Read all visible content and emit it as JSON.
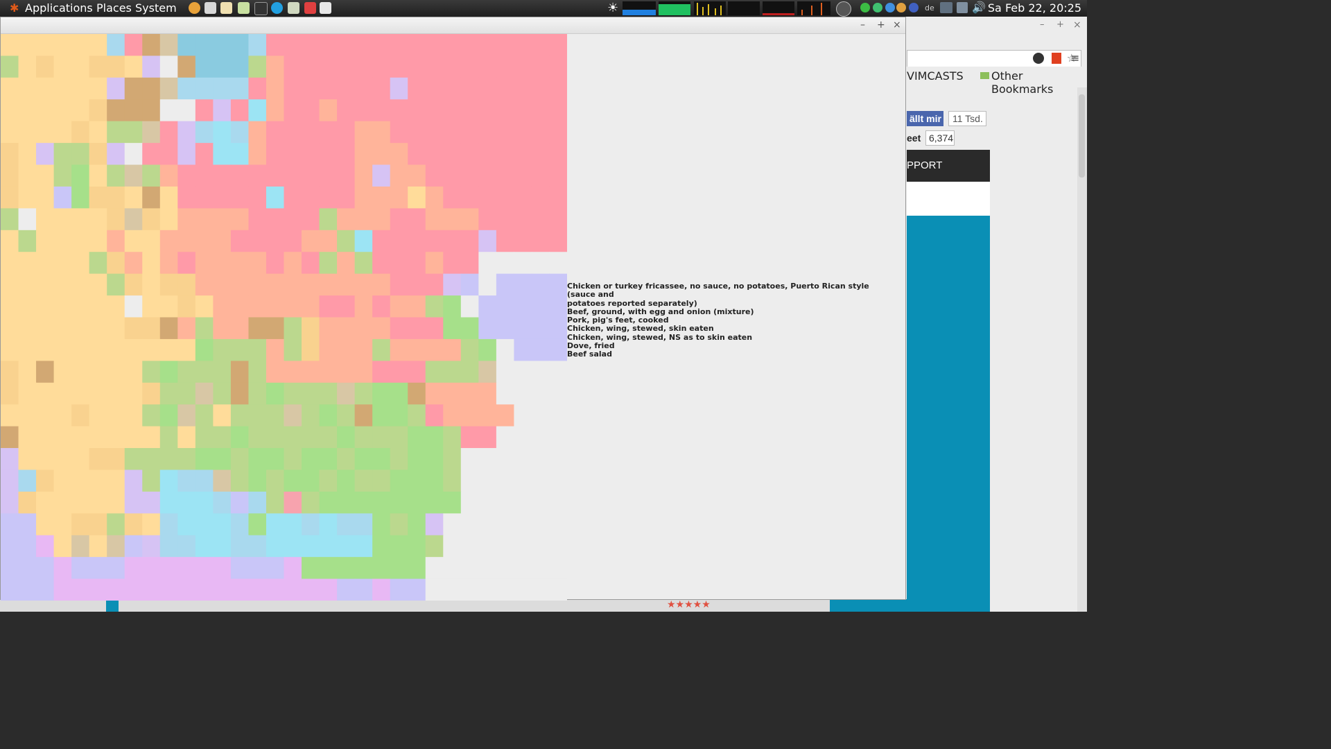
{
  "panel": {
    "menus": [
      "Applications",
      "Places",
      "System"
    ],
    "clock": "Sa Feb 22, 20:25",
    "keyboard_layout": "de"
  },
  "window": {
    "minimize": "–",
    "maximize": "+",
    "close": "×"
  },
  "food_list": [
    "Chicken or turkey fricassee, no sauce, no potatoes, Puerto Rican style (sauce and",
    "potatoes reported separately)",
    "Beef, ground, with egg and onion (mixture)",
    "Pork, pig's feet, cooked",
    "Chicken, wing, stewed, skin eaten",
    "Chicken, wing, stewed, NS as to skin eaten",
    "Dove, fried",
    "Beef salad"
  ],
  "browser": {
    "bookmark_vimcasts": "VIMCASTS",
    "bookmark_other": "Other Bookmarks",
    "like_label": "ällt mir",
    "like_count": "11 Tsd.",
    "tweet_label": "eet",
    "tweet_count": "6,374",
    "support_label": "PPORT",
    "window_min": "–",
    "window_max": "+",
    "window_close": "×"
  },
  "mosaic": {
    "colors": {
      "Y": "#FFDC9A",
      "y": "#F9D28F",
      "P": "#FF9AA8",
      "p": "#F7A3AE",
      "B": "#8ACBE0",
      "b": "#A9D9EE",
      "G": "#A6E08A",
      "g": "#BBD88E",
      "L": "#C9C6F8",
      "l": "#D6C3F4",
      "O": "#FFB49A",
      "T": "#D2A873",
      "W": "#EDEDED",
      "K": "#E8B8F4",
      "C": "#9CE4F4",
      "M": "#D8C7A5"
    },
    "rows": [
      "YYYYYYbPTMBBBBbPPPPPPPPPPPPPPPPP",
      "gYyYYyyYlWTBBBgOPPPPPPPPPPPPPPPP",
      "YYYYYYlTTMbbbbPOPPPPPPlPPPPPPPPP",
      "YYYYYyTTTWWPlPCOPPOPPPPPPPPPPPPP",
      "YYYYyYggMPlbCbOPPPPPOOPPPPPPPPPP",
      "yYlggylWPPlPCCOPPPPPOOOPPPPPPPPP",
      "yYYgGYgMgOPPPPPPPPPPOlOOPPPPPPPP",
      "yYYLGyyYTYPPPPPCPPPPOOOYOPPPPPPP",
      "gWYYYYyMyYOOOOPPPPgOOOPPOOOPPPPP",
      "YgYYYYOYYOOOOPPPPOOgCPPPPPPlPPPP",
      "YYYYYgyOYOPOOOOPOPgOgPPPOPPWWWWW",
      "YYYYYYgyYyyOOOOOOOOOOOPPPlLWLLLL",
      "YYYYYYYWYYyYOOOOOOPPOPOOgGWLLLLL",
      "YYYYYYYyyTOgOOTTgyOOOOPPPGGLLLLL",
      "YYYYYYYYYYYGgggOgyOOOgOOOOgGWLLL",
      "yYTYYYYYgGgggTgOOOOOOPPPgggMWWWW",
      "yYYYYYYYyggMgTgGgggMgGGTOOOOWWWW",
      "YYYYyYYYgGMgYgggMgGgTGGgPOOOOWWW",
      "TYYYYYYYYgYggGgggggGgggGGgPPWWWW",
      "lYYYYyyggggGGgGGgGGgGGgGGgWWWWWW",
      "lbyYYYYlgCbbMgGgGGgGggGGGgWWWWWW",
      "lyYYYYYllCCCbLbgpgGGGGGGGGWWWWWW",
      "LLYYyygyYbCCCbGCCbCbbGgGlWWWWWWW",
      "LLKYMYMLlbbCCbbCCCCCCGGGgWWWWWWW",
      "LLLKLLLKKKKKKLLLKGGGGGGGWWWWWWWW",
      "LLLKKKKKKKKKKKKKKKKLLKLLWWWWWWWW"
    ]
  }
}
